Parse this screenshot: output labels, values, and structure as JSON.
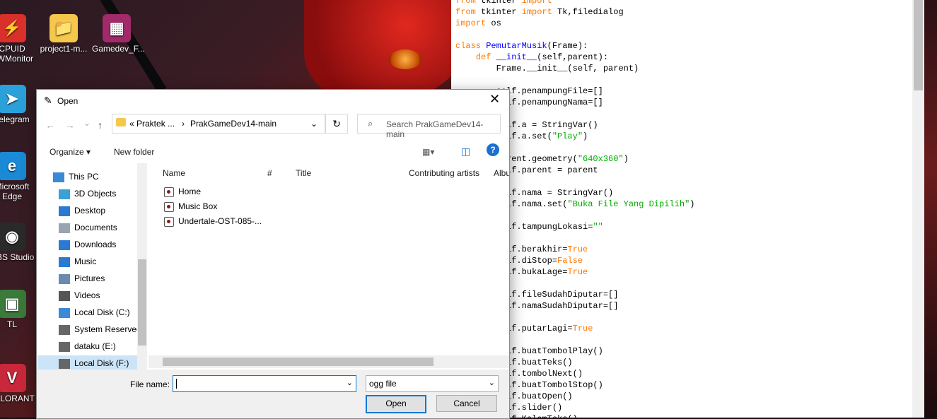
{
  "desktop": {
    "icons": [
      {
        "label_lines": [
          "CPUID",
          "HWMonitor"
        ],
        "glyph": "⚡",
        "color": "#d9302c"
      },
      {
        "label_lines": [
          "project1-m..."
        ],
        "glyph": "📁",
        "color": "#f5c84c"
      },
      {
        "label_lines": [
          "Gamedev_F..."
        ],
        "glyph": "▦",
        "color": "#a02a6a"
      },
      {
        "label_lines": [
          "Telegram"
        ],
        "glyph": "➤",
        "color": "#2aa1da"
      },
      {
        "label_lines": [
          "Microsoft",
          "Edge"
        ],
        "glyph": "e",
        "color": "#1a8ad6"
      },
      {
        "label_lines": [
          "OBS Studio"
        ],
        "glyph": "◉",
        "color": "#2a2a2a"
      },
      {
        "label_lines": [
          "TL"
        ],
        "glyph": "▣",
        "color": "#3a7a3a"
      },
      {
        "label_lines": [
          "VALORANT"
        ],
        "glyph": "V",
        "color": "#c8283a"
      }
    ]
  },
  "editor": {
    "lines": [
      [
        {
          "t": "from",
          "c": "kw"
        },
        {
          "t": " tkinter "
        },
        {
          "t": "import",
          "c": "kw"
        },
        {
          "t": " *"
        }
      ],
      [
        {
          "t": "from",
          "c": "kw"
        },
        {
          "t": " tkinter "
        },
        {
          "t": "import",
          "c": "kw"
        },
        {
          "t": " Tk,filedialog"
        }
      ],
      [
        {
          "t": "import",
          "c": "kw"
        },
        {
          "t": " os"
        }
      ],
      [],
      [
        {
          "t": "class",
          "c": "kw"
        },
        {
          "t": " "
        },
        {
          "t": "PemutarMusik",
          "c": "fn"
        },
        {
          "t": "(Frame):"
        }
      ],
      [
        {
          "t": "    "
        },
        {
          "t": "def",
          "c": "kw"
        },
        {
          "t": " "
        },
        {
          "t": "__init__",
          "c": "fn"
        },
        {
          "t": "(self,parent):"
        }
      ],
      [
        {
          "t": "        Frame.__init__(self, parent)"
        }
      ],
      [],
      [
        {
          "t": "        self.penampungFile=[]"
        }
      ],
      [
        {
          "t": "        self.penampungNama=[]"
        }
      ],
      [],
      [
        {
          "t": "        self.a = StringVar()"
        }
      ],
      [
        {
          "t": "        self.a.set("
        },
        {
          "t": "\"Play\"",
          "c": "st"
        },
        {
          "t": ")"
        }
      ],
      [],
      [
        {
          "t": "        parent.geometry("
        },
        {
          "t": "\"640x360\"",
          "c": "st"
        },
        {
          "t": ")"
        }
      ],
      [
        {
          "t": "        self.parent = parent"
        }
      ],
      [],
      [
        {
          "t": "        self.nama = StringVar()"
        }
      ],
      [
        {
          "t": "        self.nama.set("
        },
        {
          "t": "\"Buka File Yang Dipilih\"",
          "c": "st"
        },
        {
          "t": ")"
        }
      ],
      [],
      [
        {
          "t": "        self.tampungLokasi="
        },
        {
          "t": "\"\"",
          "c": "st"
        }
      ],
      [],
      [
        {
          "t": "        self.berakhir="
        },
        {
          "t": "True",
          "c": "kw"
        }
      ],
      [
        {
          "t": "        self.diStop="
        },
        {
          "t": "False",
          "c": "kw"
        }
      ],
      [
        {
          "t": "        self.bukaLage="
        },
        {
          "t": "True",
          "c": "kw"
        }
      ],
      [],
      [
        {
          "t": "        self.fileSudahDiputar=[]"
        }
      ],
      [
        {
          "t": "        self.namaSudahDiputar=[]"
        }
      ],
      [],
      [
        {
          "t": "        self.putarLagi="
        },
        {
          "t": "True",
          "c": "kw"
        }
      ],
      [],
      [
        {
          "t": "        self.buatTombolPlay()"
        }
      ],
      [
        {
          "t": "        self.buatTeks()"
        }
      ],
      [
        {
          "t": "        self.tombolNext()"
        }
      ],
      [
        {
          "t": "        self.buatTombolStop()"
        }
      ],
      [
        {
          "t": "        self.buatOpen()"
        }
      ],
      [
        {
          "t": "        self.slider()"
        }
      ],
      [
        {
          "t": "        self.KolomTeks()"
        }
      ]
    ]
  },
  "dialog": {
    "title": "Open",
    "close_glyph": "✕",
    "nav": {
      "back": "←",
      "forward": "→",
      "dropdown": "⌄",
      "up": "↑"
    },
    "address": {
      "crumb1": "« Praktek ...",
      "sep": "›",
      "crumb2": "PrakGameDev14-main",
      "dropdown": "⌄"
    },
    "refresh_glyph": "↻",
    "search_placeholder": "Search PrakGameDev14-main",
    "toolbar": {
      "organize": "Organize ▾",
      "new_folder": "New folder",
      "view": "▦▾",
      "pane": "◫",
      "help": "?"
    },
    "nav_items": [
      {
        "label": "This PC",
        "icon": "pc-icon",
        "color": "#3a8ad6"
      },
      {
        "label": "3D Objects",
        "icon": "cube-icon",
        "color": "#3aa0d6"
      },
      {
        "label": "Desktop",
        "icon": "desktop-icon",
        "color": "#2a7ad1"
      },
      {
        "label": "Documents",
        "icon": "document-icon",
        "color": "#9aa3b0"
      },
      {
        "label": "Downloads",
        "icon": "download-icon",
        "color": "#2a7ad1"
      },
      {
        "label": "Music",
        "icon": "music-icon",
        "color": "#2a7ad1"
      },
      {
        "label": "Pictures",
        "icon": "picture-icon",
        "color": "#6a8ab0"
      },
      {
        "label": "Videos",
        "icon": "video-icon",
        "color": "#555"
      },
      {
        "label": "Local Disk (C:)",
        "icon": "disk-icon",
        "color": "#3a8ad6"
      },
      {
        "label": "System Reserved",
        "icon": "disk-icon",
        "color": "#666"
      },
      {
        "label": "dataku (E:)",
        "icon": "disk-icon",
        "color": "#666"
      },
      {
        "label": "Local Disk (F:)",
        "icon": "disk-icon",
        "color": "#666",
        "selected": true
      }
    ],
    "columns": [
      "Name",
      "#",
      "Title",
      "Contributing artists",
      "Album"
    ],
    "files": [
      "Home",
      "Music Box",
      "Undertale-OST-085-..."
    ],
    "file_name_label": "File name:",
    "file_name_value": "",
    "file_type": "ogg file",
    "open_label": "Open",
    "cancel_label": "Cancel"
  }
}
